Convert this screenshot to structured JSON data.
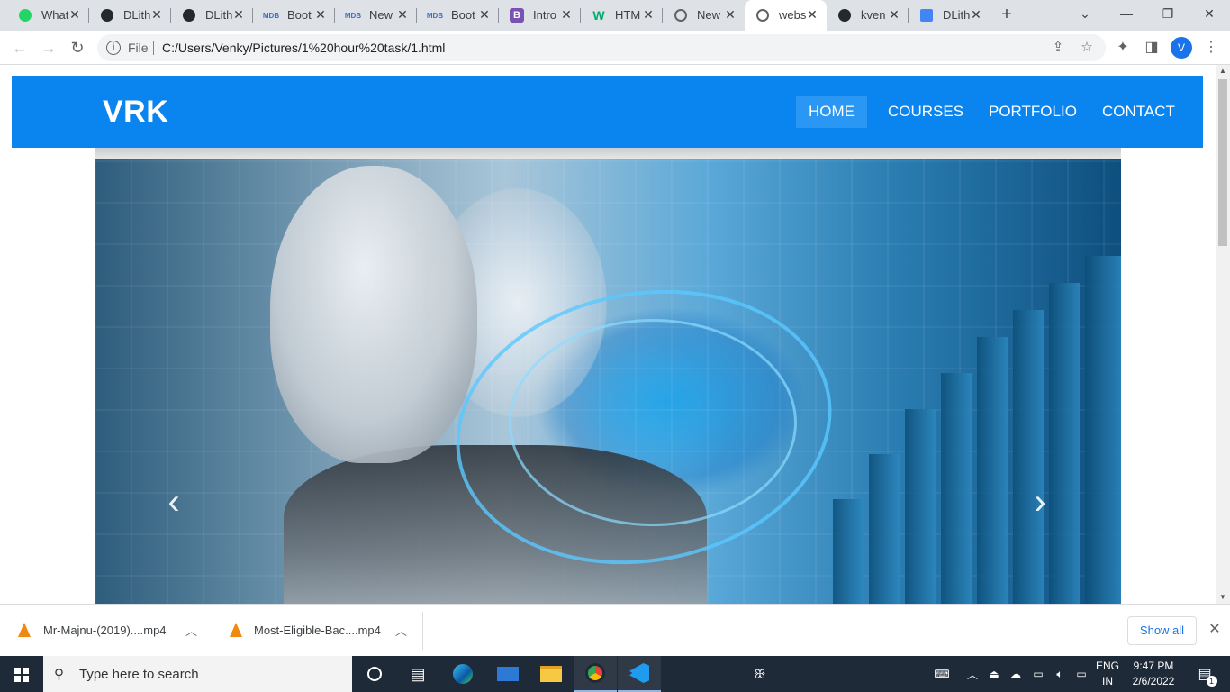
{
  "browser": {
    "tabs": [
      {
        "title": "What",
        "icon": "whatsapp-icon",
        "color": "#25d366"
      },
      {
        "title": "DLith",
        "icon": "github-icon",
        "color": "#24292e"
      },
      {
        "title": "DLith",
        "icon": "github-icon",
        "color": "#24292e"
      },
      {
        "title": "Boot",
        "icon": "mdb-icon",
        "color": "#3b71ca"
      },
      {
        "title": "New",
        "icon": "mdb-icon",
        "color": "#3b71ca"
      },
      {
        "title": "Boot",
        "icon": "mdb-icon",
        "color": "#3b71ca"
      },
      {
        "title": "Intro",
        "icon": "bootstrap-icon",
        "color": "#7952b3"
      },
      {
        "title": "HTM",
        "icon": "w3schools-icon",
        "color": "#04aa6d"
      },
      {
        "title": "New",
        "icon": "globe-icon",
        "color": "#5f6368"
      },
      {
        "title": "webs",
        "icon": "globe-icon",
        "color": "#5f6368",
        "active": true
      },
      {
        "title": "kven",
        "icon": "github-icon",
        "color": "#24292e"
      },
      {
        "title": "DLith",
        "icon": "google-sites-icon",
        "color": "#4285f4"
      }
    ],
    "address": {
      "scheme_label": "File",
      "url": "C:/Users/Venky/Pictures/1%20hour%20task/1.html"
    },
    "profile_initial": "V"
  },
  "page": {
    "brand": "VRK",
    "nav": [
      "HOME",
      "COURSES",
      "PORTFOLIO",
      "CONTACT"
    ],
    "active_nav": "HOME",
    "accent": "#0a84ef"
  },
  "downloads": {
    "items": [
      "Mr-Majnu-(2019)....mp4",
      "Most-Eligible-Bac....mp4"
    ],
    "show_all": "Show all"
  },
  "taskbar": {
    "search_placeholder": "Type here to search",
    "lang_line1": "ENG",
    "lang_line2": "IN",
    "time": "9:47 PM",
    "date": "2/6/2022",
    "notification_count": "1"
  }
}
